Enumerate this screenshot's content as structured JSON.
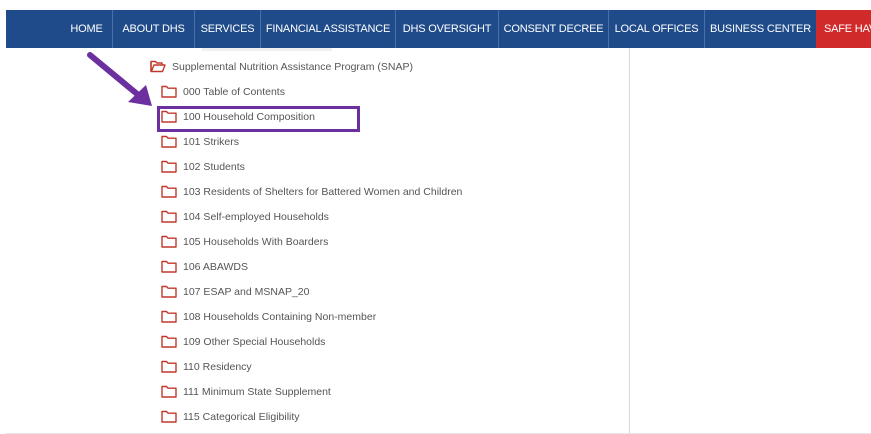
{
  "nav": {
    "items": [
      {
        "label": "HOME"
      },
      {
        "label": "ABOUT DHS"
      },
      {
        "label": "SERVICES"
      },
      {
        "label": "FINANCIAL ASSISTANCE"
      },
      {
        "label": "DHS OVERSIGHT"
      },
      {
        "label": "CONSENT DECREE"
      },
      {
        "label": "LOCAL OFFICES"
      },
      {
        "label": "BUSINESS CENTER"
      },
      {
        "label": "SAFE HAVEN"
      }
    ],
    "bg_color": "#1f4b8a",
    "safe_color": "#d12a2a"
  },
  "tree": {
    "root_label": "Supplemental Nutrition Assistance Program (SNAP)",
    "items": [
      {
        "label": "000 Table of Contents"
      },
      {
        "label": "100 Household Composition"
      },
      {
        "label": "101 Strikers"
      },
      {
        "label": "102 Students"
      },
      {
        "label": "103 Residents of Shelters for Battered Women and Children"
      },
      {
        "label": "104 Self-employed Households"
      },
      {
        "label": "105 Households With Boarders"
      },
      {
        "label": "106 ABAWDS"
      },
      {
        "label": "107 ESAP and MSNAP_20"
      },
      {
        "label": "108 Households Containing Non-member"
      },
      {
        "label": "109 Other Special Households"
      },
      {
        "label": "110 Residency"
      },
      {
        "label": "111 Minimum State Supplement"
      },
      {
        "label": "115 Categorical Eligibility"
      }
    ],
    "folder_color": "#c0392b"
  },
  "annotation": {
    "color": "#6b2fa0"
  }
}
